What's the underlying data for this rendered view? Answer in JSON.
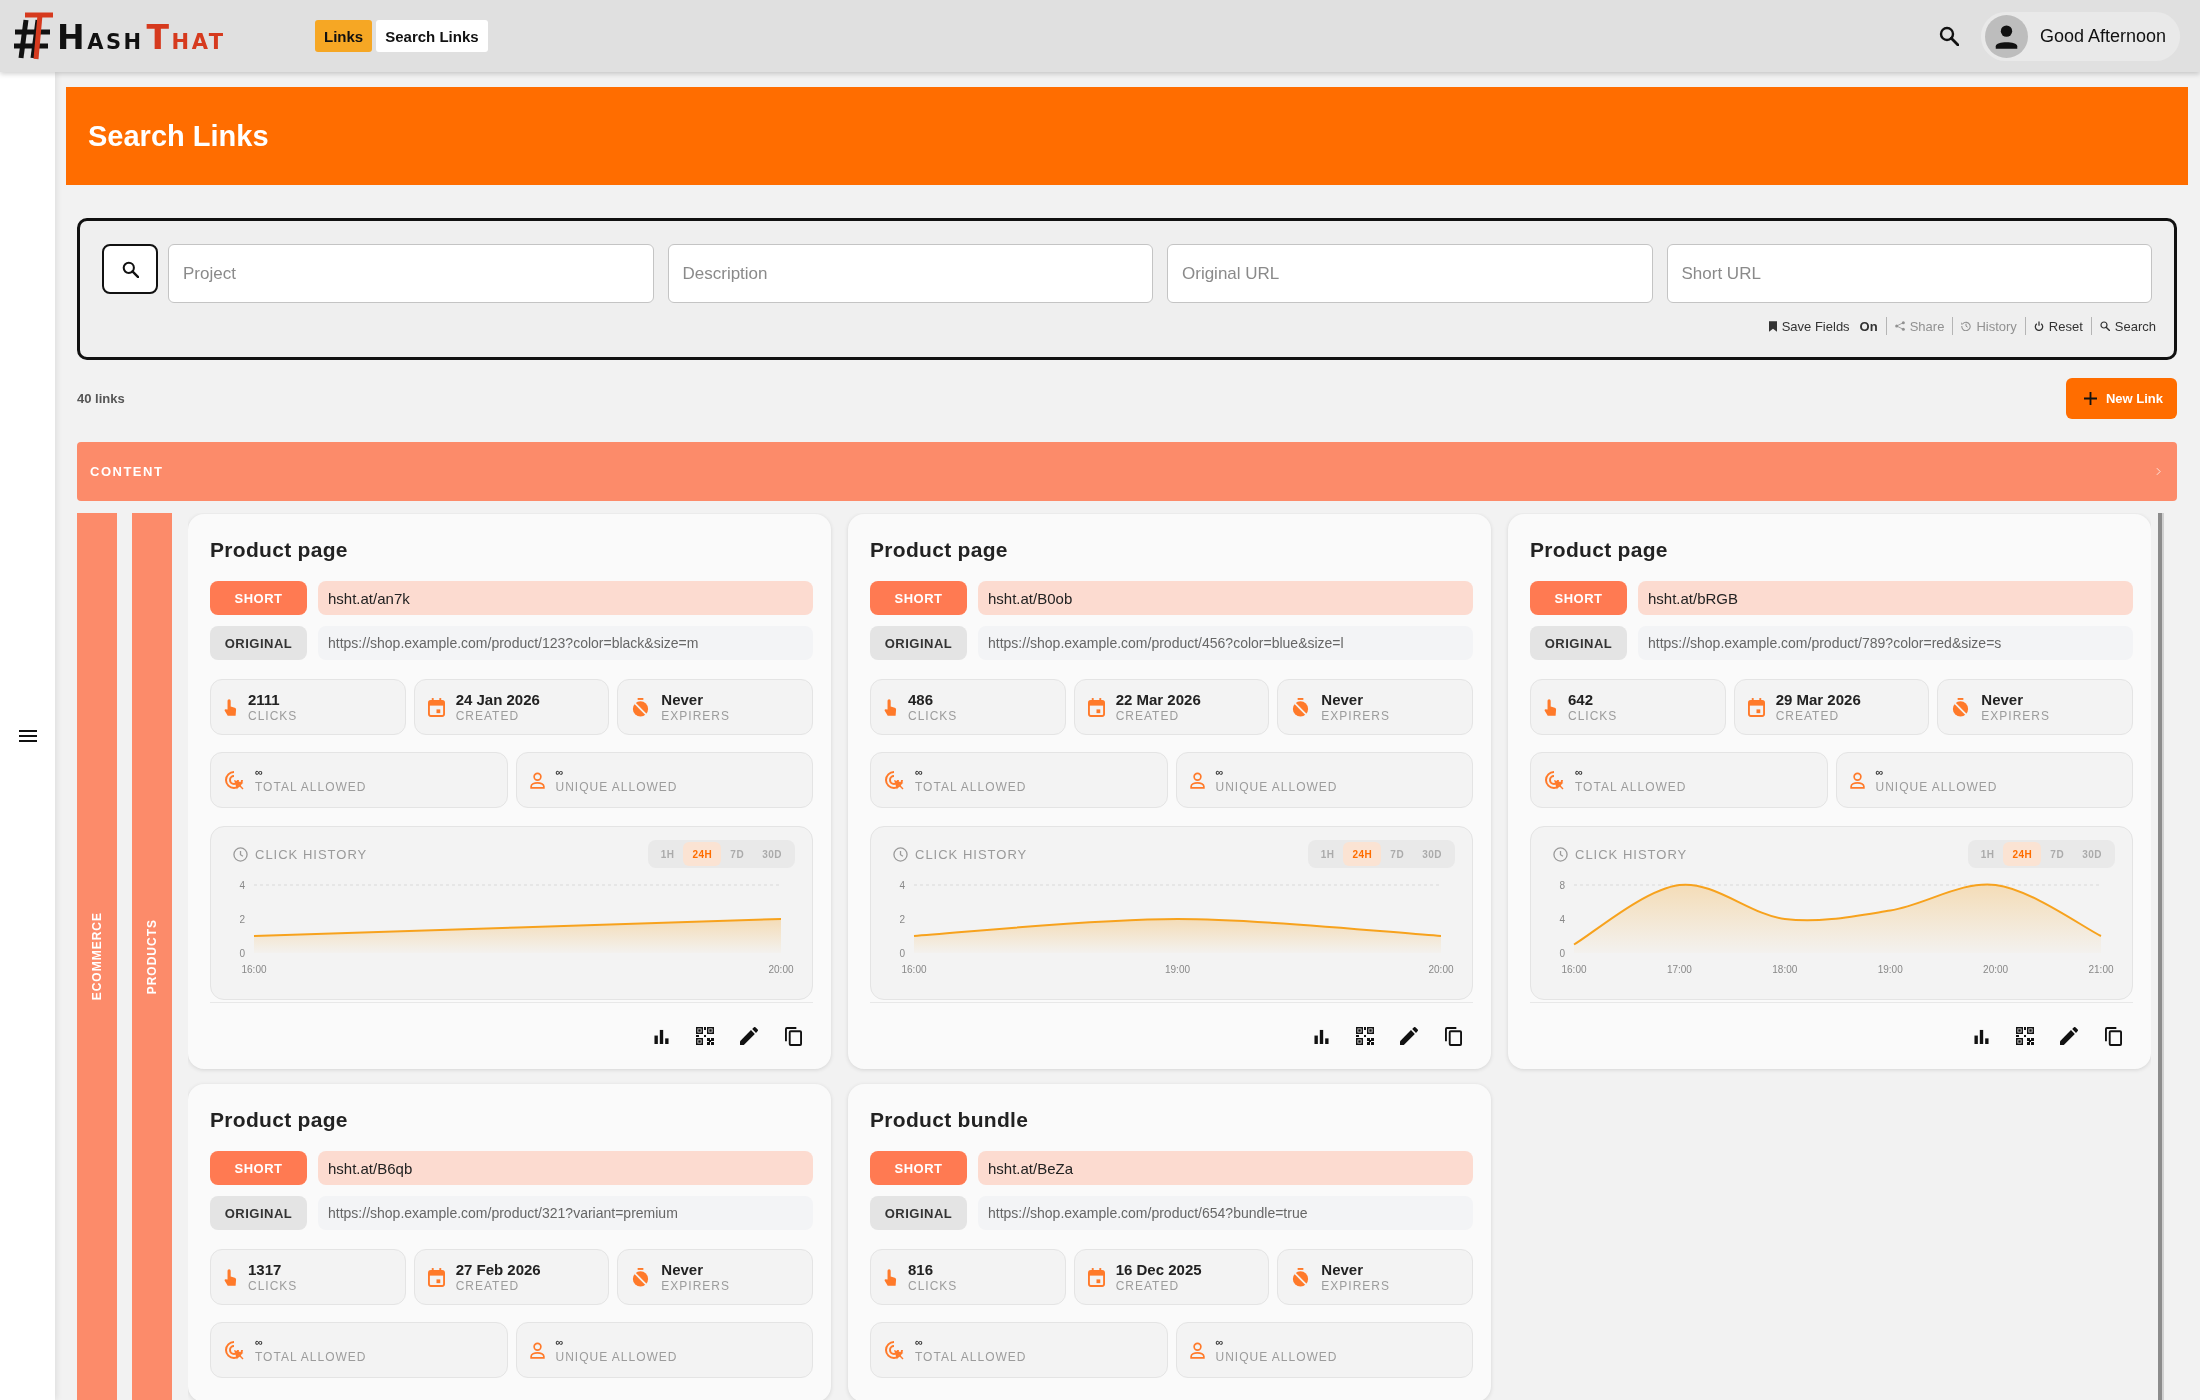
{
  "header": {
    "logo": [
      {
        "text": "HASH",
        "color": "#111111"
      },
      {
        "text": "THAT",
        "color": "#d63a1e"
      }
    ],
    "tabs": [
      {
        "label": "Links",
        "selected": true
      },
      {
        "label": "Search Links",
        "selected": false
      }
    ],
    "greeting": "Good Afternoon"
  },
  "page_title": "Search Links",
  "search_panel": {
    "fields": [
      {
        "placeholder": "Project"
      },
      {
        "placeholder": "Description"
      },
      {
        "placeholder": "Original URL"
      },
      {
        "placeholder": "Short URL"
      }
    ],
    "actions": [
      {
        "kind": "save",
        "label": "Save Fields",
        "value": "On",
        "disabled": false
      },
      {
        "kind": "share",
        "label": "Share",
        "disabled": true
      },
      {
        "kind": "history",
        "label": "History",
        "disabled": true
      },
      {
        "kind": "reset",
        "label": "Reset",
        "disabled": false
      },
      {
        "kind": "search",
        "label": "Search",
        "disabled": false
      }
    ]
  },
  "link_count": "40 links",
  "new_link_button": "New Link",
  "groups": [
    {
      "label": "CONTENT",
      "children": [
        {
          "label": "ECOMMERCE",
          "children": [
            {
              "label": "PRODUCTS",
              "links": [
                {
                  "title": "Product page",
                  "short": {
                    "label": "SHORT",
                    "url": "hsht.at/an7k"
                  },
                  "original": {
                    "label": "ORIGINAL",
                    "url": "https://shop.example.com/product/123?color=black&size=m"
                  },
                  "stats": [
                    {
                      "kind": "clicks",
                      "value": "2111",
                      "label": "CLICKS"
                    },
                    {
                      "kind": "created",
                      "value": "24 Jan 2026",
                      "label": "CREATED"
                    },
                    {
                      "kind": "expires",
                      "value": "Never",
                      "label": "EXPIRERS"
                    }
                  ],
                  "limits": [
                    {
                      "kind": "total",
                      "value": "∞",
                      "label": "TOTAL ALLOWED"
                    },
                    {
                      "kind": "unique",
                      "value": "∞",
                      "label": "UNIQUE ALLOWED"
                    }
                  ],
                  "click_history": {
                    "ranges": [
                      {
                        "label": "1H",
                        "selected": false
                      },
                      {
                        "label": "24H",
                        "selected": true
                      },
                      {
                        "label": "7D",
                        "selected": false
                      },
                      {
                        "label": "30D",
                        "selected": false
                      }
                    ],
                    "chart_data": {
                      "type": "area",
                      "title": "CLICK HISTORY",
                      "categories": [
                        "16:00",
                        "20:00"
                      ],
                      "values": [
                        1,
                        2
                      ],
                      "ylim": [
                        0,
                        4
                      ],
                      "yticks": [
                        0,
                        2,
                        4
                      ]
                    }
                  }
                },
                {
                  "title": "Product page",
                  "short": {
                    "label": "SHORT",
                    "url": "hsht.at/B0ob"
                  },
                  "original": {
                    "label": "ORIGINAL",
                    "url": "https://shop.example.com/product/456?color=blue&size=l"
                  },
                  "stats": [
                    {
                      "kind": "clicks",
                      "value": "486",
                      "label": "CLICKS"
                    },
                    {
                      "kind": "created",
                      "value": "22 Mar 2026",
                      "label": "CREATED"
                    },
                    {
                      "kind": "expires",
                      "value": "Never",
                      "label": "EXPIRERS"
                    }
                  ],
                  "limits": [
                    {
                      "kind": "total",
                      "value": "∞",
                      "label": "TOTAL ALLOWED"
                    },
                    {
                      "kind": "unique",
                      "value": "∞",
                      "label": "UNIQUE ALLOWED"
                    }
                  ],
                  "click_history": {
                    "ranges": [
                      {
                        "label": "1H",
                        "selected": false
                      },
                      {
                        "label": "24H",
                        "selected": true
                      },
                      {
                        "label": "7D",
                        "selected": false
                      },
                      {
                        "label": "30D",
                        "selected": false
                      }
                    ],
                    "chart_data": {
                      "type": "area",
                      "title": "CLICK HISTORY",
                      "categories": [
                        "16:00",
                        "19:00",
                        "20:00"
                      ],
                      "values": [
                        1,
                        2,
                        1
                      ],
                      "ylim": [
                        0,
                        4
                      ],
                      "yticks": [
                        0,
                        2,
                        4
                      ]
                    }
                  }
                },
                {
                  "title": "Product page",
                  "short": {
                    "label": "SHORT",
                    "url": "hsht.at/bRGB"
                  },
                  "original": {
                    "label": "ORIGINAL",
                    "url": "https://shop.example.com/product/789?color=red&size=s"
                  },
                  "stats": [
                    {
                      "kind": "clicks",
                      "value": "642",
                      "label": "CLICKS"
                    },
                    {
                      "kind": "created",
                      "value": "29 Mar 2026",
                      "label": "CREATED"
                    },
                    {
                      "kind": "expires",
                      "value": "Never",
                      "label": "EXPIRERS"
                    }
                  ],
                  "limits": [
                    {
                      "kind": "total",
                      "value": "∞",
                      "label": "TOTAL ALLOWED"
                    },
                    {
                      "kind": "unique",
                      "value": "∞",
                      "label": "UNIQUE ALLOWED"
                    }
                  ],
                  "click_history": {
                    "ranges": [
                      {
                        "label": "1H",
                        "selected": false
                      },
                      {
                        "label": "24H",
                        "selected": true
                      },
                      {
                        "label": "7D",
                        "selected": false
                      },
                      {
                        "label": "30D",
                        "selected": false
                      }
                    ],
                    "chart_data": {
                      "type": "area",
                      "title": "CLICK HISTORY",
                      "categories": [
                        "16:00",
                        "17:00",
                        "18:00",
                        "19:00",
                        "20:00",
                        "21:00"
                      ],
                      "values": [
                        1,
                        8,
                        4,
                        5,
                        8,
                        2
                      ],
                      "ylim": [
                        0,
                        8
                      ],
                      "yticks": [
                        0,
                        4,
                        8
                      ]
                    }
                  }
                },
                {
                  "title": "Product page",
                  "short": {
                    "label": "SHORT",
                    "url": "hsht.at/B6qb"
                  },
                  "original": {
                    "label": "ORIGINAL",
                    "url": "https://shop.example.com/product/321?variant=premium"
                  },
                  "stats": [
                    {
                      "kind": "clicks",
                      "value": "1317",
                      "label": "CLICKS"
                    },
                    {
                      "kind": "created",
                      "value": "27 Feb 2026",
                      "label": "CREATED"
                    },
                    {
                      "kind": "expires",
                      "value": "Never",
                      "label": "EXPIRERS"
                    }
                  ],
                  "limits": [
                    {
                      "kind": "total",
                      "value": "∞",
                      "label": "TOTAL ALLOWED"
                    },
                    {
                      "kind": "unique",
                      "value": "∞",
                      "label": "UNIQUE ALLOWED"
                    }
                  ]
                },
                {
                  "title": "Product bundle",
                  "short": {
                    "label": "SHORT",
                    "url": "hsht.at/BeZa"
                  },
                  "original": {
                    "label": "ORIGINAL",
                    "url": "https://shop.example.com/product/654?bundle=true"
                  },
                  "stats": [
                    {
                      "kind": "clicks",
                      "value": "816",
                      "label": "CLICKS"
                    },
                    {
                      "kind": "created",
                      "value": "16 Dec 2025",
                      "label": "CREATED"
                    },
                    {
                      "kind": "expires",
                      "value": "Never",
                      "label": "EXPIRERS"
                    }
                  ],
                  "limits": [
                    {
                      "kind": "total",
                      "value": "∞",
                      "label": "TOTAL ALLOWED"
                    },
                    {
                      "kind": "unique",
                      "value": "∞",
                      "label": "UNIQUE ALLOWED"
                    }
                  ]
                }
              ]
            }
          ]
        }
      ]
    }
  ]
}
